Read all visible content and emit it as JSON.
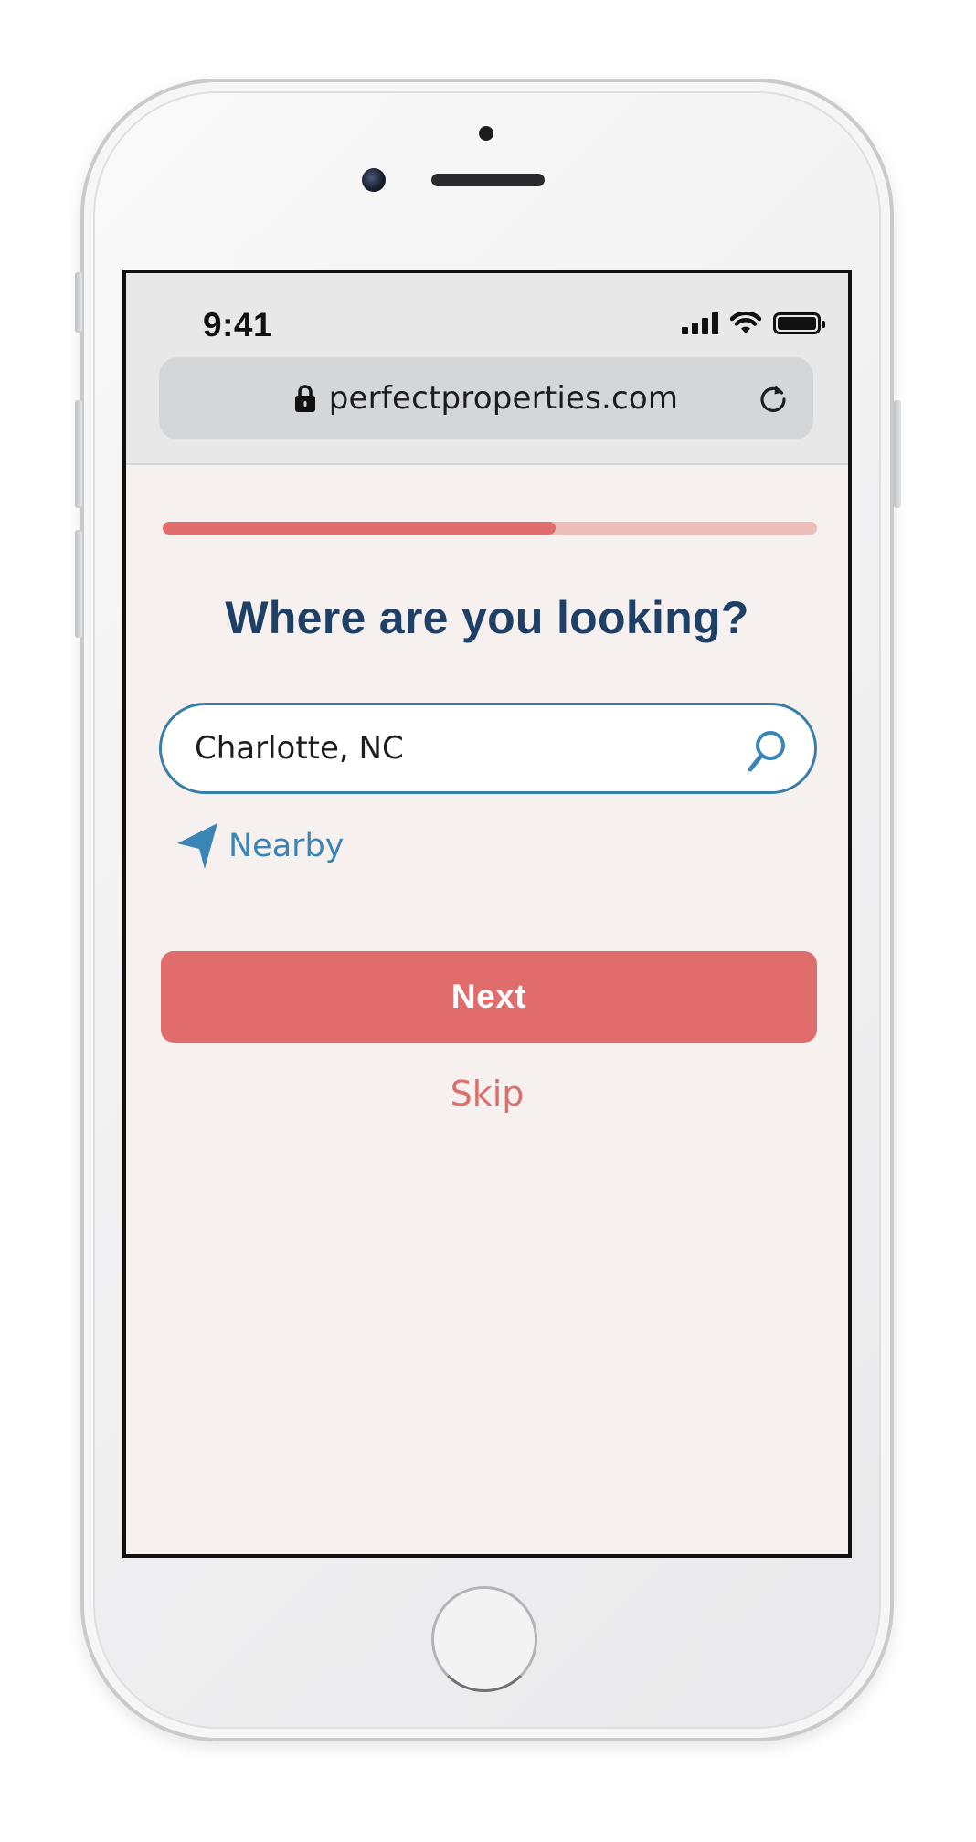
{
  "status_bar": {
    "time": "9:41"
  },
  "browser": {
    "url": "perfectproperties.com"
  },
  "progress": {
    "fraction": 0.6
  },
  "main": {
    "heading": "Where are you looking?",
    "search": {
      "value": "Charlotte, NC",
      "placeholder": ""
    },
    "nearby_label": "Nearby",
    "next_label": "Next",
    "skip_label": "Skip"
  },
  "colors": {
    "accent": "#e16c6c",
    "accent_light": "#edbdb9",
    "heading": "#1e3f66",
    "link_blue": "#3a85b5",
    "input_border": "#3a7ea8",
    "screen_bg": "#f6f1ee"
  },
  "icons": {
    "lock": "lock-icon",
    "reload": "reload-icon",
    "search": "search-icon",
    "nearby": "location-arrow-icon",
    "signal": "cellular-signal-icon",
    "wifi": "wifi-icon",
    "battery": "battery-icon"
  }
}
